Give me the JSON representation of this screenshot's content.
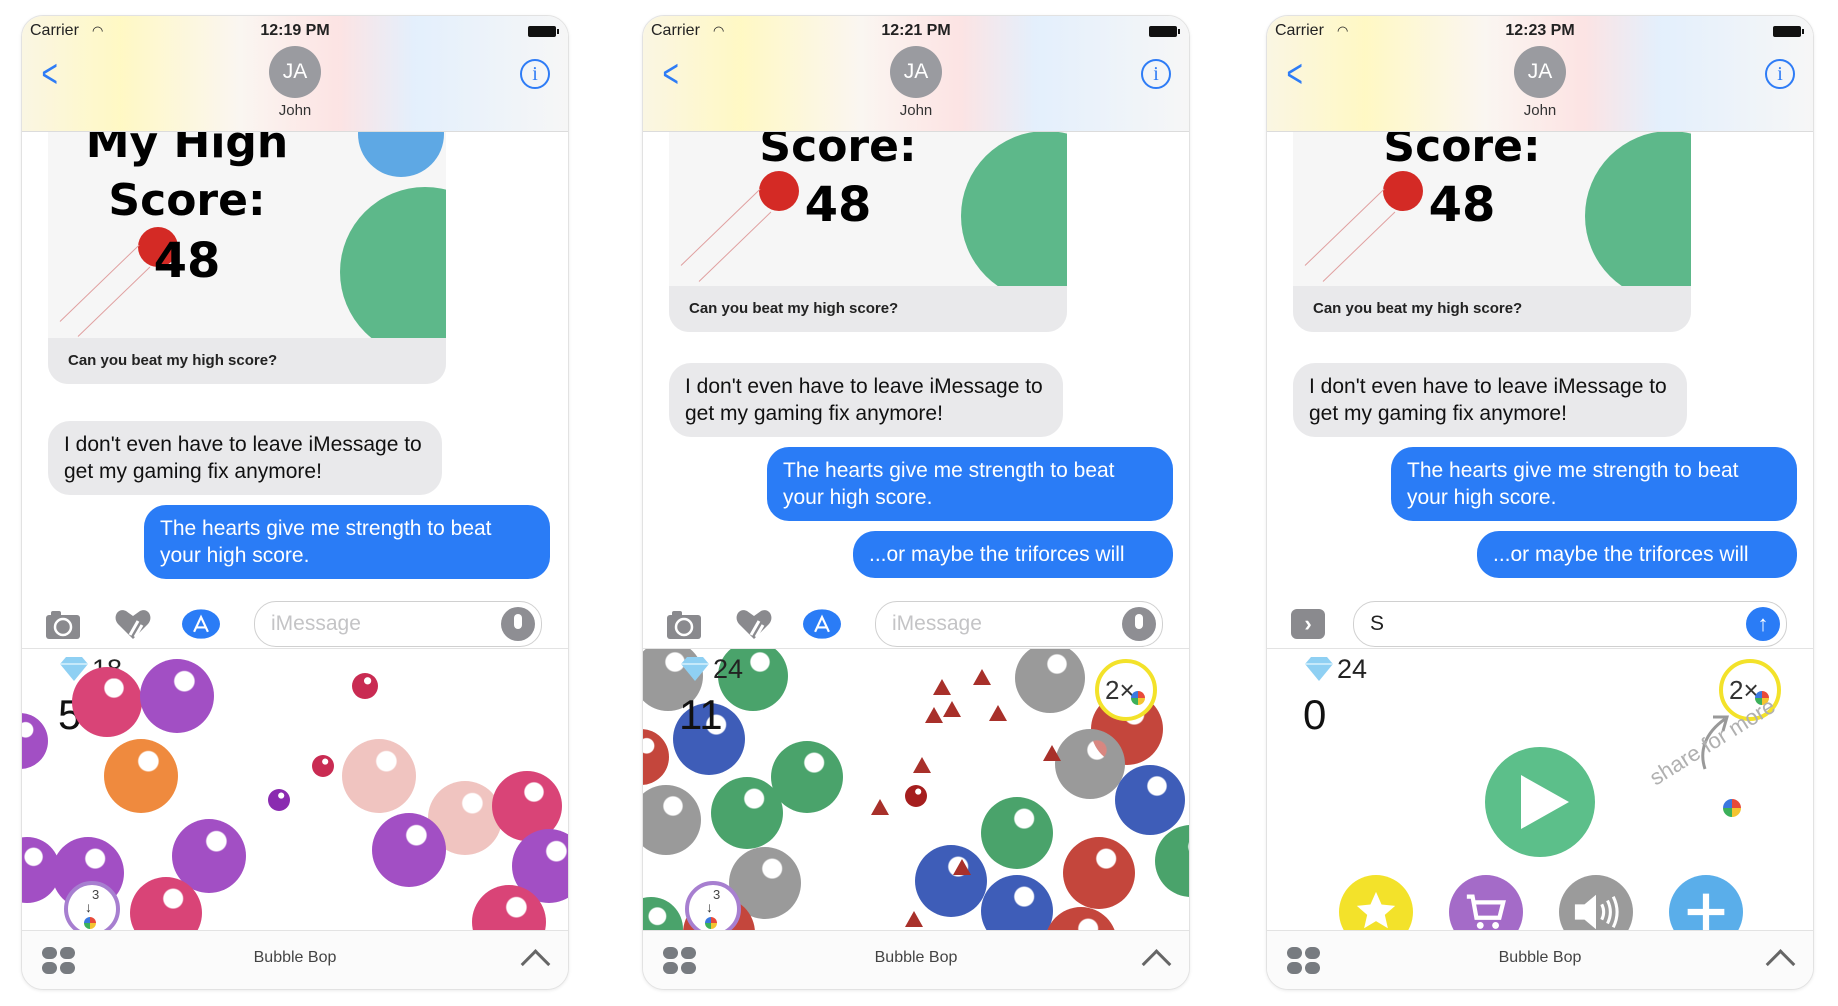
{
  "app_name": "Bubble Bop",
  "colors": {
    "ios_blue": "#2a7cf6",
    "bubble_gray": "#e9e9eb",
    "play_green": "#5cbf8a",
    "star_yellow": "#f3e22a",
    "cart_purple": "#a46bc8",
    "sound_gray": "#9b9b9b",
    "plus_blue": "#5aaeea"
  },
  "phones": [
    {
      "status": {
        "carrier": "Carrier",
        "time": "12:19 PM"
      },
      "contact": {
        "initials": "JA",
        "name": "John"
      },
      "card": {
        "title_lines": [
          "My High",
          "Score:",
          "48"
        ],
        "caption": "Can you beat my high score?"
      },
      "messages": [
        {
          "from": "them",
          "text": "I don't even have to leave iMessage to get my gaming fix anymore!"
        },
        {
          "from": "me",
          "text": "The hearts give me strength to beat your high score."
        }
      ],
      "input": {
        "placeholder": "iMessage",
        "value": ""
      },
      "game": {
        "gems": "18",
        "score": "5",
        "share_gems": "3",
        "mode": "playing-hearts"
      }
    },
    {
      "status": {
        "carrier": "Carrier",
        "time": "12:21 PM"
      },
      "contact": {
        "initials": "JA",
        "name": "John"
      },
      "card": {
        "title_lines": [
          "Score:",
          "48"
        ],
        "caption": "Can you beat my high score?"
      },
      "messages": [
        {
          "from": "them",
          "text": "I don't even have to leave iMessage to get my gaming fix anymore!"
        },
        {
          "from": "me",
          "text": "The hearts give me strength to beat your high score."
        },
        {
          "from": "me",
          "text": "...or maybe the triforces will"
        }
      ],
      "input": {
        "placeholder": "iMessage",
        "value": ""
      },
      "game": {
        "gems": "24",
        "score": "11",
        "share_gems": "3",
        "multiplier": "2×",
        "mode": "playing-triforce"
      }
    },
    {
      "status": {
        "carrier": "Carrier",
        "time": "12:23 PM"
      },
      "contact": {
        "initials": "JA",
        "name": "John"
      },
      "card": {
        "title_lines": [
          "Score:",
          "48"
        ],
        "caption": "Can you beat my high score?"
      },
      "messages": [
        {
          "from": "them",
          "text": "I don't even have to leave iMessage to get my gaming fix anymore!"
        },
        {
          "from": "me",
          "text": "The hearts give me strength to beat your high score."
        },
        {
          "from": "me",
          "text": "...or maybe the triforces will"
        }
      ],
      "input": {
        "placeholder": "",
        "value": "S"
      },
      "game": {
        "gems": "24",
        "score": "0",
        "multiplier": "2×",
        "share_hint": "share for more",
        "mode": "menu"
      }
    }
  ]
}
